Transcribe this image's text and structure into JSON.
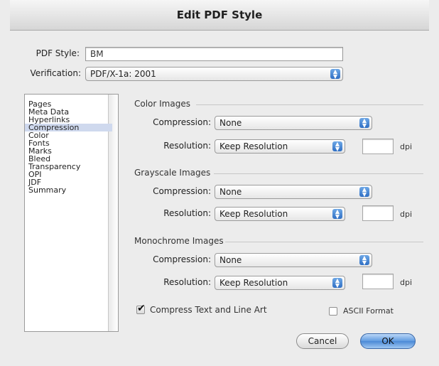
{
  "window": {
    "title": "Edit PDF Style"
  },
  "style_field": {
    "label": "PDF Style:",
    "value": "BM"
  },
  "verification": {
    "label": "Verification:",
    "value": "PDF/X-1a: 2001"
  },
  "sidebar": {
    "items": [
      {
        "label": "Pages"
      },
      {
        "label": "Meta Data"
      },
      {
        "label": "Hyperlinks"
      },
      {
        "label": "Compression"
      },
      {
        "label": "Color"
      },
      {
        "label": "Fonts"
      },
      {
        "label": "Marks"
      },
      {
        "label": "Bleed"
      },
      {
        "label": "Transparency"
      },
      {
        "label": "OPI"
      },
      {
        "label": "JDF"
      },
      {
        "label": "Summary"
      }
    ],
    "selected": "Compression"
  },
  "sections": {
    "color": {
      "title": "Color Images",
      "compression_label": "Compression:",
      "compression_value": "None",
      "resolution_label": "Resolution:",
      "resolution_value": "Keep Resolution",
      "dpi_value": "",
      "unit": "dpi"
    },
    "grayscale": {
      "title": "Grayscale Images",
      "compression_label": "Compression:",
      "compression_value": "None",
      "resolution_label": "Resolution:",
      "resolution_value": "Keep Resolution",
      "dpi_value": "",
      "unit": "dpi"
    },
    "monochrome": {
      "title": "Monochrome Images",
      "compression_label": "Compression:",
      "compression_value": "None",
      "resolution_label": "Resolution:",
      "resolution_value": "Keep Resolution",
      "dpi_value": "",
      "unit": "dpi"
    }
  },
  "options": {
    "compress_text": {
      "label": "Compress Text and Line Art",
      "checked": true
    },
    "ascii_format": {
      "label": "ASCII Format",
      "checked": false
    }
  },
  "buttons": {
    "cancel": "Cancel",
    "ok": "OK"
  },
  "colors": {
    "accent": "#4b89d6",
    "selection": "#cfd9ee"
  }
}
